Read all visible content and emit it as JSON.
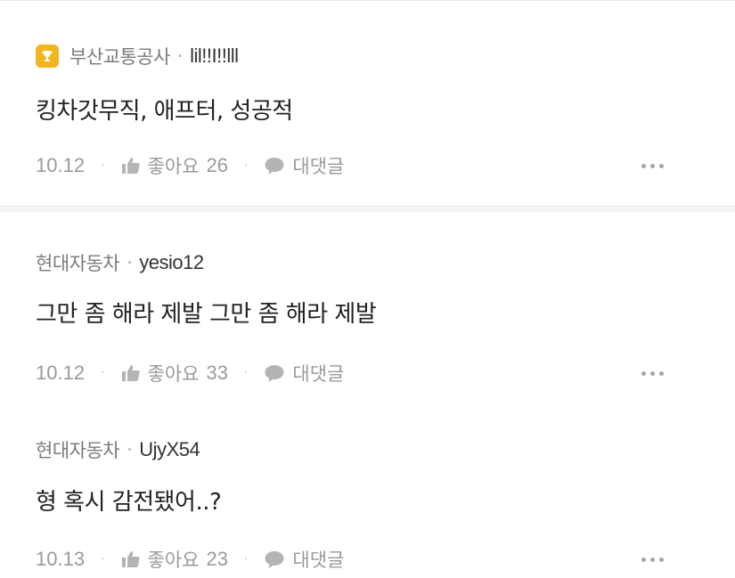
{
  "comments": [
    {
      "company": "부산교통공사",
      "username": "lil!!I!!lll",
      "has_badge": true,
      "text": "킹차갓무직, 애프터, 성공적",
      "date": "10.12",
      "like_label": "좋아요",
      "like_count": "26",
      "reply_label": "대댓글"
    },
    {
      "company": "현대자동차",
      "username": "yesio12",
      "has_badge": false,
      "text": "그만 좀 해라 제발 그만 좀 해라 제발",
      "date": "10.12",
      "like_label": "좋아요",
      "like_count": "33",
      "reply_label": "대댓글"
    },
    {
      "company": "현대자동차",
      "username": "UjyX54",
      "has_badge": false,
      "text": "형 혹시 감전됐어..?",
      "date": "10.13",
      "like_label": "좋아요",
      "like_count": "23",
      "reply_label": "대댓글"
    }
  ],
  "separator_dot": "·",
  "icons": {
    "badge": "trophy-icon",
    "like": "thumbs-up-icon",
    "reply": "speech-bubble-icon",
    "more": "more-horizontal-icon"
  },
  "colors": {
    "badge": "#f3b51e",
    "meta": "#7b7b7b",
    "muted": "#9a9a9a",
    "text": "#222222"
  }
}
